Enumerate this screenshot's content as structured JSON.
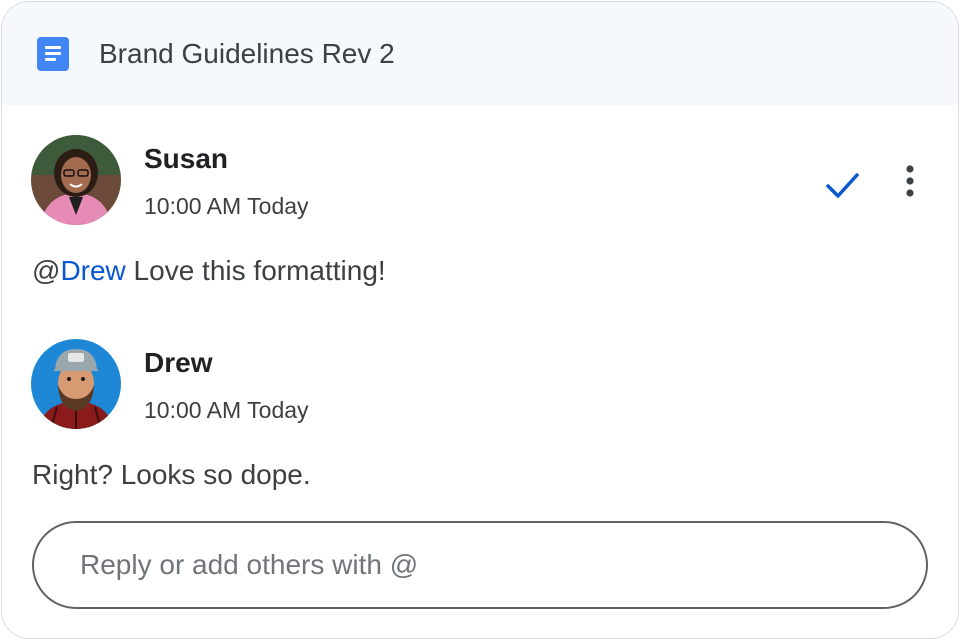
{
  "header": {
    "icon": "google-docs-icon",
    "title": "Brand Guidelines Rev 2"
  },
  "comments": [
    {
      "author": "Susan",
      "time": "10:00 AM Today",
      "mention_prefix": "@",
      "mention": "Drew",
      "text": " Love this formatting!",
      "avatar": "avatar-photo"
    },
    {
      "author": "Drew",
      "time": "10:00 AM Today",
      "text": "Right? Looks so dope.",
      "avatar": "avatar-illustration"
    }
  ],
  "actions": {
    "resolve_icon": "checkmark-icon",
    "more_icon": "more-vert-icon"
  },
  "reply": {
    "placeholder": "Reply or add others with @",
    "value": ""
  },
  "colors": {
    "header_bg": "#f5f8fc",
    "accent": "#0b57d0",
    "doc_icon": "#4285f4"
  }
}
